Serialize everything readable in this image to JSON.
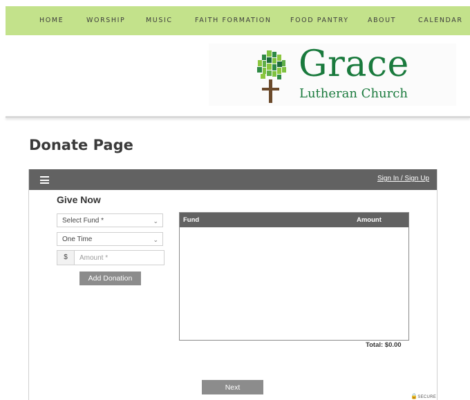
{
  "nav": {
    "items": [
      {
        "label": "HOME"
      },
      {
        "label": "WORSHIP"
      },
      {
        "label": "MUSIC"
      },
      {
        "label": "FAITH FORMATION"
      },
      {
        "label": "FOOD PANTRY"
      },
      {
        "label": "ABOUT"
      },
      {
        "label": "CALENDAR"
      }
    ]
  },
  "logo": {
    "name": "Grace",
    "subtitle": "Lutheran Church",
    "icon": "tree-cross-icon"
  },
  "page": {
    "title": "Donate Page"
  },
  "widget": {
    "menu_icon": "hamburger-icon",
    "signin_label": "Sign In / Sign Up",
    "heading": "Give Now",
    "fund_select": {
      "value": "Select Fund *"
    },
    "frequency_select": {
      "value": "One Time"
    },
    "currency_symbol": "$",
    "amount_placeholder": "Amount *",
    "add_button": "Add Donation",
    "table": {
      "columns": [
        "Fund",
        "Amount"
      ],
      "rows": []
    },
    "total": "Total: $0.00",
    "next_button": "Next",
    "secure_label": "SECURE",
    "secure_icon": "lock-icon"
  },
  "colors": {
    "nav_bg": "#c3e28b",
    "brand_green": "#1a7a3d",
    "bar_gray": "#626262",
    "button_gray": "#8c8c8c"
  }
}
